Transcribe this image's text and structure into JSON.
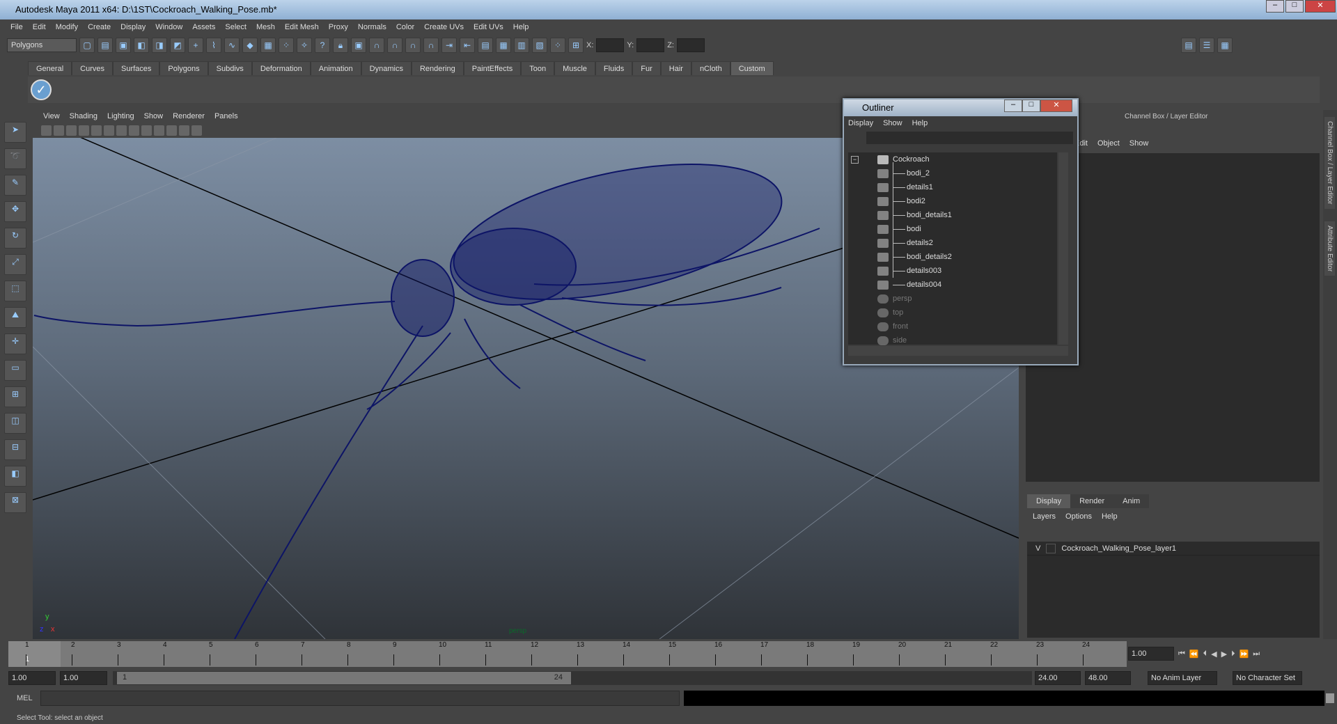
{
  "title": "Autodesk Maya 2011 x64: D:\\1ST\\Cockroach_Walking_Pose.mb*",
  "menubar": [
    "File",
    "Edit",
    "Modify",
    "Create",
    "Display",
    "Window",
    "Assets",
    "Select",
    "Mesh",
    "Edit Mesh",
    "Proxy",
    "Normals",
    "Color",
    "Create UVs",
    "Edit UVs",
    "Help"
  ],
  "mode_select": "Polygons",
  "coords": {
    "x": "X:",
    "y": "Y:",
    "z": "Z:"
  },
  "shelf_tabs": [
    "General",
    "Curves",
    "Surfaces",
    "Polygons",
    "Subdivs",
    "Deformation",
    "Animation",
    "Dynamics",
    "Rendering",
    "PaintEffects",
    "Toon",
    "Muscle",
    "Fluids",
    "Fur",
    "Hair",
    "nCloth",
    "Custom"
  ],
  "active_shelf": "Custom",
  "viewport": {
    "menu": [
      "View",
      "Shading",
      "Lighting",
      "Show",
      "Renderer",
      "Panels"
    ],
    "camera": "persp",
    "axis_y": "y",
    "axis_z": "z",
    "axis_x": "x",
    "wire_color": "#0d1466"
  },
  "outliner": {
    "title": "Outliner",
    "menu": [
      "Display",
      "Show",
      "Help"
    ],
    "root": "Cockroach",
    "children": [
      "bodi_2",
      "details1",
      "bodi2",
      "bodi_details1",
      "bodi",
      "details2",
      "bodi_details2",
      "details003",
      "details004"
    ],
    "cameras": [
      "persp",
      "top",
      "front",
      "side"
    ]
  },
  "channel_box": {
    "title": "Channel Box / Layer Editor",
    "menu": [
      "Edit",
      "Object",
      "Show"
    ]
  },
  "side_tabs": [
    "Channel Box / Layer Editor",
    "Attribute Editor"
  ],
  "layer_editor": {
    "tabs": [
      "Display",
      "Render",
      "Anim"
    ],
    "active": "Display",
    "menu": [
      "Layers",
      "Options",
      "Help"
    ],
    "layers": [
      {
        "visible": "V",
        "name": "Cockroach_Walking_Pose_layer1"
      }
    ]
  },
  "timeline": {
    "ticks": [
      "1",
      "2",
      "3",
      "4",
      "5",
      "6",
      "7",
      "8",
      "9",
      "10",
      "11",
      "12",
      "13",
      "14",
      "15",
      "16",
      "17",
      "18",
      "19",
      "20",
      "21",
      "22",
      "23",
      "24"
    ],
    "current": "1",
    "current_field": "1.00"
  },
  "range": {
    "start": "1.00",
    "playback_start": "1.00",
    "slider_start": "1",
    "slider_end": "24",
    "playback_end": "24.00",
    "end": "48.00",
    "anim_layer": "No Anim Layer",
    "character_set": "No Character Set"
  },
  "mel": {
    "label": "MEL"
  },
  "help_line": "Select Tool: select an object"
}
